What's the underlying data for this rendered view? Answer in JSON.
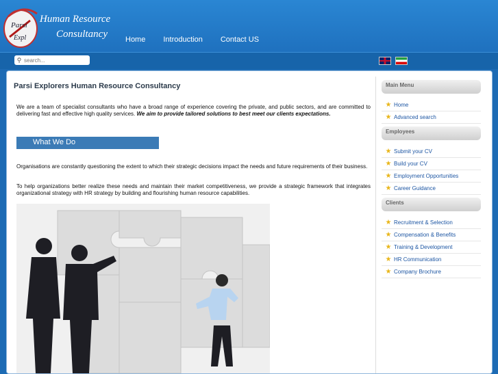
{
  "logo": {
    "line1": "Human Resource",
    "line2": "Consultancy",
    "badge_text": "Parsi Explorers"
  },
  "nav": {
    "items": [
      "Home",
      "Introduction",
      "Contact US"
    ]
  },
  "search": {
    "placeholder": "search..."
  },
  "languages": [
    {
      "name": "English",
      "icon": "flag-uk-icon"
    },
    {
      "name": "Persian",
      "icon": "flag-iran-icon"
    }
  ],
  "main": {
    "title": "Parsi Explorers Human Resource Consultancy",
    "intro_normal": "We are a team of specialist consultants who have a broad range of experience covering the private, and public sectors, and  are committed to delivering  fast and effective high quality services. ",
    "intro_emphasis": "We aim to provide tailored solutions to best meet our clients expectations.",
    "section_title": "What We Do",
    "para1": "Organisations are constantly questioning the extent to which their strategic decisions impact the needs and future requirements of their business.",
    "para2": "To help organizations better realize these needs and maintain their market competitiveness, we  provide a strategic framework that integrates organizational strategy with HR strategy by building and flourishing human resource capabilities."
  },
  "sidebar": {
    "main_menu": {
      "heading": "Main Menu",
      "items": [
        "Home",
        "Advanced search"
      ]
    },
    "employees": {
      "heading": "Employees",
      "items": [
        "Submit your CV",
        "Build your CV",
        "Employment Opportunities",
        "Career Guidance"
      ]
    },
    "clients": {
      "heading": "Clients",
      "items": [
        "Recruitment & Selection",
        "Compensation & Benefits",
        "Training & Development",
        "HR Communication",
        "Company Brochure"
      ]
    }
  },
  "colors": {
    "header_blue": "#1d6bb4",
    "section_bar": "#3b7bb6",
    "link": "#1d56a3"
  }
}
